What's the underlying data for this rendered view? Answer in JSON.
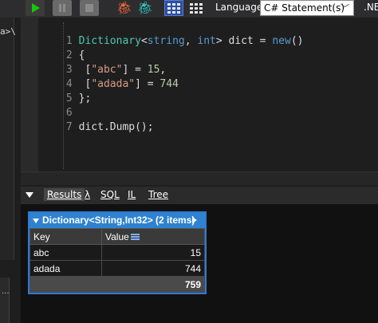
{
  "toolbar": {
    "language_label": "Language",
    "language_value": "C# Statement(s)",
    "framework_label": ".NE"
  },
  "left_panel": {
    "text": "a>\\",
    "dots": "..."
  },
  "editor": {
    "lines": [
      {
        "n": "1",
        "text": "Dictionary<string, int> dict = new()"
      },
      {
        "n": "2",
        "text": "{"
      },
      {
        "n": "3",
        "text": " [\"abc\"] = 15,"
      },
      {
        "n": "4",
        "text": " [\"adada\"] = 744"
      },
      {
        "n": "5",
        "text": "};"
      },
      {
        "n": "6",
        "text": ""
      },
      {
        "n": "7",
        "text": "dict.Dump();"
      }
    ]
  },
  "result_tabs": {
    "results": "Results",
    "lambda": "λ",
    "sql": "SQL",
    "il": "IL",
    "tree": "Tree"
  },
  "dump": {
    "title": "Dictionary<String,Int32> (2 items)",
    "columns": [
      "Key",
      "Value"
    ],
    "rows": [
      {
        "key": "abc",
        "value": "15"
      },
      {
        "key": "adada",
        "value": "744"
      }
    ],
    "total": "759"
  },
  "colors": {
    "accent_blue": "#2f82cf",
    "play_green": "#16c60c",
    "keyword": "#569cd6",
    "type": "#4ec9b0",
    "string": "#d69d85",
    "number": "#b5cea8"
  }
}
